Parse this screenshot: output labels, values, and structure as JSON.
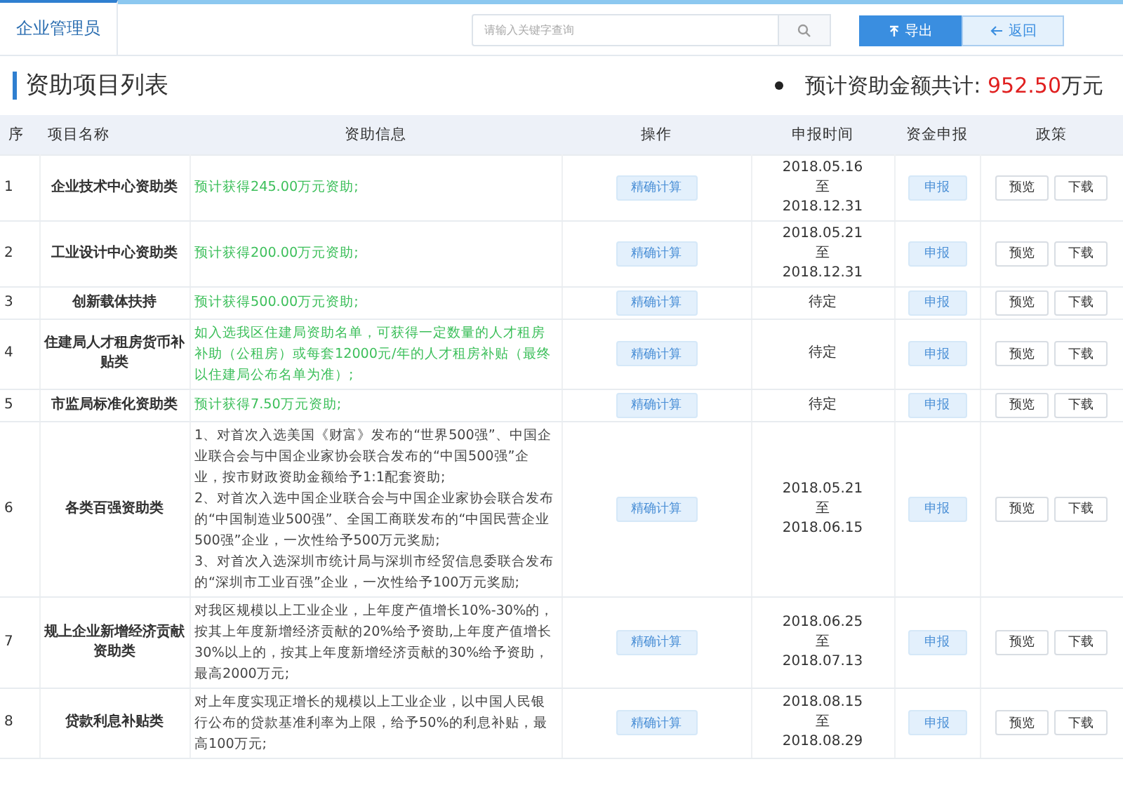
{
  "top_bar": {
    "tab": {
      "label": "企业管理员",
      "selected": true
    },
    "search": {
      "placeholder": "请输入关键字查询"
    },
    "buttons": [
      {
        "label": "导出",
        "kind": "primary"
      },
      {
        "label": "返回",
        "kind": "secondary"
      }
    ]
  },
  "heading": {
    "title": "资助项目列表",
    "total_label": "预计资助金额共计: ",
    "total_value": "952.50",
    "total_unit": "万元"
  },
  "table": {
    "columns": [
      "序",
      "项目名称",
      "资助信息",
      "操作",
      "申报时间",
      "资金申报",
      "政策"
    ],
    "rows": [
      {
        "index": "1",
        "name": "企业技术中心资助类",
        "kind": "estimate",
        "info": [
          "预计获得245.00万元资助;"
        ],
        "action": "精确计算",
        "time": [
          "2018.05.16",
          "至",
          "2018.12.31"
        ],
        "apply": "申报",
        "policy": [
          "预览",
          "下载"
        ]
      },
      {
        "index": "2",
        "name": "工业设计中心资助类",
        "kind": "estimate",
        "info": [
          "预计获得200.00万元资助;"
        ],
        "action": "精确计算",
        "time": [
          "2018.05.21",
          "至",
          "2018.12.31"
        ],
        "apply": "申报",
        "policy": [
          "预览",
          "下载"
        ]
      },
      {
        "index": "3",
        "name": "创新载体扶持",
        "kind": "estimate",
        "info": [
          "预计获得500.00万元资助;"
        ],
        "action": "精确计算",
        "time": [
          "待定"
        ],
        "apply": "申报",
        "policy": [
          "预览",
          "下载"
        ]
      },
      {
        "index": "4",
        "name": "住建局人才租房货币补贴类",
        "kind": "estimate",
        "info": [
          "如入选我区住建局资助名单，可获得一定数量的人才租房补助（公租房）或每套12000元/年的人才租房补贴（最终以住建局公布名单为准）;"
        ],
        "action": "精确计算",
        "time": [
          "待定"
        ],
        "apply": "申报",
        "policy": [
          "预览",
          "下载"
        ]
      },
      {
        "index": "5",
        "name": "市监局标准化资助类",
        "kind": "estimate",
        "info": [
          "预计获得7.50万元资助;"
        ],
        "action": "精确计算",
        "time": [
          "待定"
        ],
        "apply": "申报",
        "policy": [
          "预览",
          "下载"
        ]
      },
      {
        "index": "6",
        "name": "各类百强资助类",
        "kind": "rule",
        "info": [
          "1、对首次入选美国《财富》发布的“世界500强”、中国企业联合会与中国企业家协会联合发布的“中国500强”企业，按市财政资助金额给予1:1配套资助;",
          "2、对首次入选中国企业联合会与中国企业家协会联合发布的“中国制造业500强”、全国工商联发布的“中国民营企业500强”企业，一次性给予500万元奖励;",
          "3、对首次入选深圳市统计局与深圳市经贸信息委联合发布的“深圳市工业百强”企业，一次性给予100万元奖励;"
        ],
        "action": "精确计算",
        "time": [
          "2018.05.21",
          "至",
          "2018.06.15"
        ],
        "apply": "申报",
        "policy": [
          "预览",
          "下载"
        ]
      },
      {
        "index": "7",
        "name": "规上企业新增经济贡献资助类",
        "kind": "rule",
        "info": [
          "对我区规模以上工业企业，上年度产值增长10%-30%的，按其上年度新增经济贡献的20%给予资助,上年度产值增长30%以上的，按其上年度新增经济贡献的30%给予资助，最高2000万元;"
        ],
        "action": "精确计算",
        "time": [
          "2018.06.25",
          "至",
          "2018.07.13"
        ],
        "apply": "申报",
        "policy": [
          "预览",
          "下载"
        ]
      },
      {
        "index": "8",
        "name": "贷款利息补贴类",
        "kind": "rule",
        "info": [
          "对上年度实现正增长的规模以上工业企业，以中国人民银行公布的贷款基准利率为上限，给予50%的利息补贴，最高100万元;"
        ],
        "action": "精确计算",
        "time": [
          "2018.08.15",
          "至",
          "2018.08.29"
        ],
        "apply": "申报",
        "policy": [
          "预览",
          "下载"
        ]
      }
    ]
  }
}
